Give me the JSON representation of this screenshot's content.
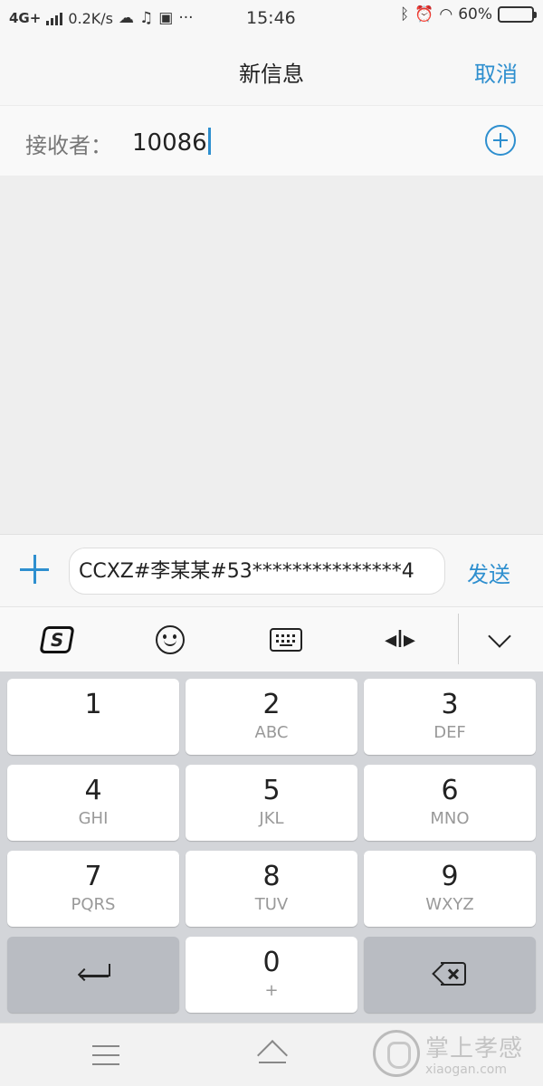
{
  "status_bar": {
    "network": "4G+",
    "speed": "0.2K/s",
    "more": "···",
    "time": "15:46",
    "battery_text": "60%",
    "battery_level": 0.6
  },
  "header": {
    "title": "新信息",
    "cancel_label": "取消"
  },
  "recipient": {
    "label": "接收者：",
    "value": "10086"
  },
  "compose": {
    "message": "CCXZ#李某某#53***************4",
    "send_label": "发送"
  },
  "keyboard_toolbar": {
    "logo_letter": "S",
    "cursor_move_glyph": "◂I▸",
    "icons": [
      "sogou-logo-icon",
      "emoji-icon",
      "keyboard-icon",
      "cursor-move-icon",
      "collapse-chevron-icon"
    ]
  },
  "keypad": {
    "keys": [
      {
        "digit": "1",
        "letters": ""
      },
      {
        "digit": "2",
        "letters": "ABC"
      },
      {
        "digit": "3",
        "letters": "DEF"
      },
      {
        "digit": "4",
        "letters": "GHI"
      },
      {
        "digit": "5",
        "letters": "JKL"
      },
      {
        "digit": "6",
        "letters": "MNO"
      },
      {
        "digit": "7",
        "letters": "PQRS"
      },
      {
        "digit": "8",
        "letters": "TUV"
      },
      {
        "digit": "9",
        "letters": "WXYZ"
      },
      {
        "digit": "0",
        "letters": "+"
      }
    ]
  },
  "watermark": {
    "text": "掌上孝感",
    "url": "xiaogan.com"
  },
  "colors": {
    "accent": "#2e8fcf",
    "keypad_bg": "#d3d5d9",
    "function_key": "#b9bcc2"
  }
}
